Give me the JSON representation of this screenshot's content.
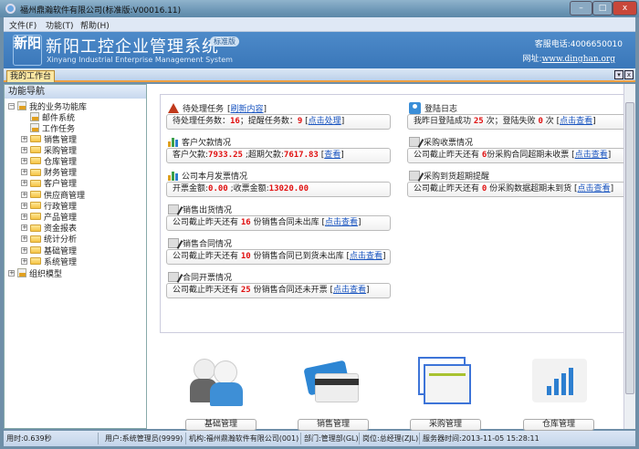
{
  "window": {
    "title": "福州鼎瀚软件有限公司(标准版:V00016.11)",
    "minimize": "–",
    "maximize": "□",
    "close": "x"
  },
  "menu": [
    {
      "label": "文件(F)"
    },
    {
      "label": "功能(T)"
    },
    {
      "label": "帮助(H)"
    }
  ],
  "banner": {
    "logo": "新阳",
    "title": "新阳工控企业管理系统",
    "edition": "标准版",
    "subtitle": "Xinyang Industrial Enterprise Management System",
    "hotline_label": "客服电话:",
    "hotline": "4006650010",
    "website_label": "网址:",
    "website": "www.dinghan.org"
  },
  "tabs": [
    {
      "label": "我的工作台"
    }
  ],
  "tab_controls": {
    "dropdown": "▾",
    "close": "x"
  },
  "nav": {
    "title": "功能导航",
    "root": "我的业务功能库",
    "leaves": [
      "邮件系统",
      "工作任务"
    ],
    "folders": [
      "销售管理",
      "采购管理",
      "仓库管理",
      "财务管理",
      "客户管理",
      "供应商管理",
      "行政管理",
      "产品管理",
      "资金报表",
      "统计分析",
      "基础管理",
      "系统管理"
    ],
    "org": "组织模型"
  },
  "left_col": [
    {
      "icon": "warning-icon",
      "title": "待处理任务",
      "title_link": "刷新内容",
      "parts": [
        "待处理任务数：",
        "16",
        "；提醒任务数：",
        "9"
      ],
      "link": "点击处理"
    },
    {
      "icon": "bar-chart-icon",
      "title": "客户欠款情况",
      "parts": [
        "客户欠款:",
        "7933.25",
        " ;超期欠款:",
        "7617.83"
      ],
      "link": "查看"
    },
    {
      "icon": "bar-chart-icon",
      "title": "公司本月发票情况",
      "parts": [
        "开票金额:",
        "0.00",
        " ;收票金额:",
        "13020.00"
      ]
    },
    {
      "icon": "note-icon",
      "title": "销售出货情况",
      "parts": [
        "公司截止昨天还有 ",
        "16",
        " 份销售合同未出库"
      ],
      "link": "点击查看"
    },
    {
      "icon": "note-icon",
      "title": "销售合同情况",
      "parts": [
        "公司截止昨天还有 ",
        "10",
        " 份销售合同已到货未出库"
      ],
      "link": "点击查看"
    },
    {
      "icon": "note-icon",
      "title": "合同开票情况",
      "parts": [
        "公司截止昨天还有 ",
        "25",
        " 份销售合同还未开票"
      ],
      "link": "点击查看"
    }
  ],
  "right_col": [
    {
      "icon": "user-icon",
      "title": "登陆日志",
      "parts": [
        "我昨日登陆成功 ",
        "25",
        " 次；登陆失败 ",
        "0",
        " 次"
      ],
      "link": "点击查看"
    },
    {
      "icon": "note-icon",
      "title": "采购收票情况",
      "parts": [
        "公司截止昨天还有 ",
        "6",
        "份采购合同超期未收票"
      ],
      "link": "点击查看"
    },
    {
      "icon": "note-icon",
      "title": "采购到货超期提醒",
      "parts": [
        "公司截止昨天还有 ",
        "0",
        " 份采购数据超期未到货"
      ],
      "link": "点击查看"
    }
  ],
  "quick": [
    "基础管理",
    "销售管理",
    "采购管理",
    "仓库管理"
  ],
  "status": {
    "time": "用时:0.639秒",
    "user": "用户:系统管理员(9999)",
    "org": "机构:福州鼎瀚软件有限公司(001)",
    "dept": "部门:管理部(GL)",
    "post": "岗位:总经理(ZJL)",
    "server": "服务器时间:2013-11-05 15:28:11"
  }
}
